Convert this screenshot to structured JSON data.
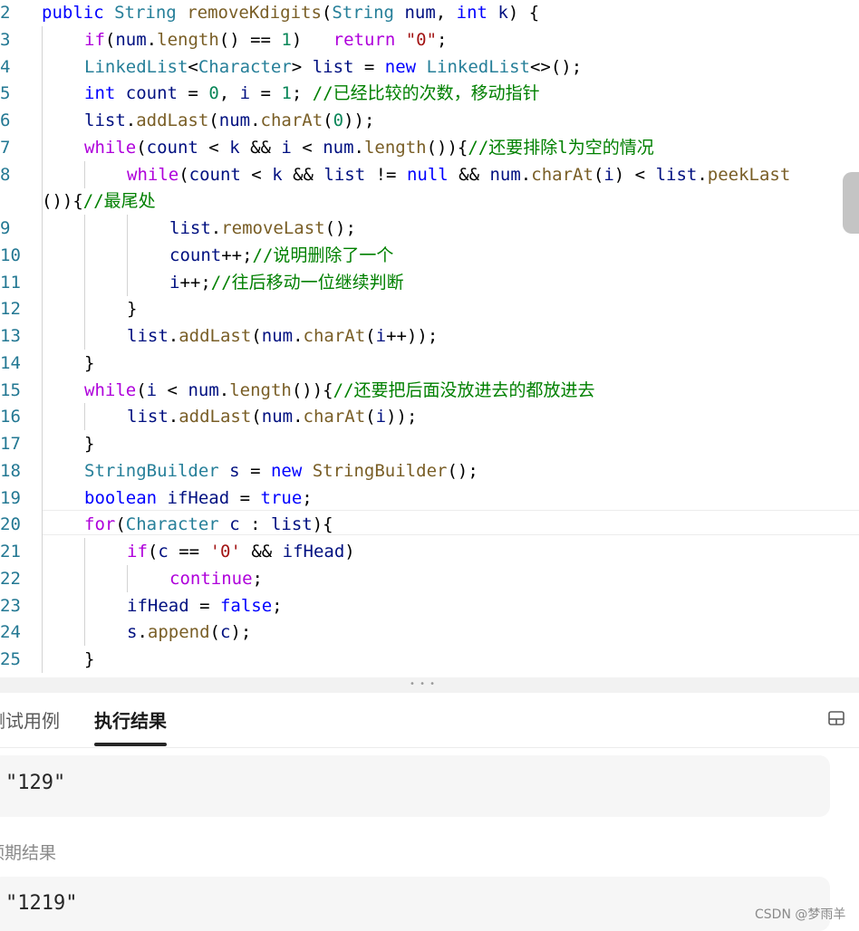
{
  "editor": {
    "lines": [
      {
        "num": "2",
        "indent": 0,
        "tokens": [
          [
            "k",
            "public"
          ],
          [
            "p",
            " "
          ],
          [
            "t",
            "String"
          ],
          [
            "p",
            " "
          ],
          [
            "f",
            "removeKdigits"
          ],
          [
            "p",
            "("
          ],
          [
            "t",
            "String"
          ],
          [
            "p",
            " "
          ],
          [
            "v",
            "num"
          ],
          [
            "p",
            ", "
          ],
          [
            "k",
            "int"
          ],
          [
            "p",
            " "
          ],
          [
            "v",
            "k"
          ],
          [
            "p",
            ") {"
          ]
        ]
      },
      {
        "num": "3",
        "indent": 1,
        "tokens": [
          [
            "c",
            "if"
          ],
          [
            "p",
            "("
          ],
          [
            "v",
            "num"
          ],
          [
            "p",
            "."
          ],
          [
            "f",
            "length"
          ],
          [
            "p",
            "() == "
          ],
          [
            "n",
            "1"
          ],
          [
            "p",
            ")   "
          ],
          [
            "c",
            "return"
          ],
          [
            "p",
            " "
          ],
          [
            "s",
            "\"0\""
          ],
          [
            "p",
            ";"
          ]
        ]
      },
      {
        "num": "4",
        "indent": 1,
        "tokens": [
          [
            "t",
            "LinkedList"
          ],
          [
            "p",
            "<"
          ],
          [
            "t",
            "Character"
          ],
          [
            "p",
            "> "
          ],
          [
            "v",
            "list"
          ],
          [
            "p",
            " = "
          ],
          [
            "k",
            "new"
          ],
          [
            "p",
            " "
          ],
          [
            "t",
            "LinkedList"
          ],
          [
            "p",
            "<>();"
          ]
        ]
      },
      {
        "num": "5",
        "indent": 1,
        "tokens": [
          [
            "k",
            "int"
          ],
          [
            "p",
            " "
          ],
          [
            "v",
            "count"
          ],
          [
            "p",
            " = "
          ],
          [
            "n",
            "0"
          ],
          [
            "p",
            ", "
          ],
          [
            "v",
            "i"
          ],
          [
            "p",
            " = "
          ],
          [
            "n",
            "1"
          ],
          [
            "p",
            "; "
          ],
          [
            "m",
            "//已经比较的次数，移动指针"
          ]
        ]
      },
      {
        "num": "6",
        "indent": 1,
        "tokens": [
          [
            "v",
            "list"
          ],
          [
            "p",
            "."
          ],
          [
            "f",
            "addLast"
          ],
          [
            "p",
            "("
          ],
          [
            "v",
            "num"
          ],
          [
            "p",
            "."
          ],
          [
            "f",
            "charAt"
          ],
          [
            "p",
            "("
          ],
          [
            "n",
            "0"
          ],
          [
            "p",
            "));"
          ]
        ]
      },
      {
        "num": "7",
        "indent": 1,
        "tokens": [
          [
            "c",
            "while"
          ],
          [
            "p",
            "("
          ],
          [
            "v",
            "count"
          ],
          [
            "p",
            " < "
          ],
          [
            "v",
            "k"
          ],
          [
            "p",
            " && "
          ],
          [
            "v",
            "i"
          ],
          [
            "p",
            " < "
          ],
          [
            "v",
            "num"
          ],
          [
            "p",
            "."
          ],
          [
            "f",
            "length"
          ],
          [
            "p",
            "()){"
          ],
          [
            "m",
            "//还要排除l为空的情况"
          ]
        ]
      },
      {
        "num": "8",
        "indent": 2,
        "tokens": [
          [
            "c",
            "while"
          ],
          [
            "p",
            "("
          ],
          [
            "v",
            "count"
          ],
          [
            "p",
            " < "
          ],
          [
            "v",
            "k"
          ],
          [
            "p",
            " && "
          ],
          [
            "v",
            "list"
          ],
          [
            "p",
            " != "
          ],
          [
            "k",
            "null"
          ],
          [
            "p",
            " && "
          ],
          [
            "v",
            "num"
          ],
          [
            "p",
            "."
          ],
          [
            "f",
            "charAt"
          ],
          [
            "p",
            "("
          ],
          [
            "v",
            "i"
          ],
          [
            "p",
            ") < "
          ],
          [
            "v",
            "list"
          ],
          [
            "p",
            "."
          ],
          [
            "f",
            "peekLast"
          ]
        ]
      },
      {
        "num": "",
        "indent": 0,
        "wrap": true,
        "tokens": [
          [
            "p",
            "()){"
          ],
          [
            "m",
            "//最尾处"
          ]
        ]
      },
      {
        "num": "9",
        "indent": 3,
        "tokens": [
          [
            "v",
            "list"
          ],
          [
            "p",
            "."
          ],
          [
            "f",
            "removeLast"
          ],
          [
            "p",
            "();"
          ]
        ]
      },
      {
        "num": "10",
        "indent": 3,
        "tokens": [
          [
            "v",
            "count"
          ],
          [
            "p",
            "++;"
          ],
          [
            "m",
            "//说明删除了一个"
          ]
        ]
      },
      {
        "num": "11",
        "indent": 3,
        "tokens": [
          [
            "v",
            "i"
          ],
          [
            "p",
            "++;"
          ],
          [
            "m",
            "//往后移动一位继续判断"
          ]
        ]
      },
      {
        "num": "12",
        "indent": 2,
        "tokens": [
          [
            "p",
            "}"
          ]
        ]
      },
      {
        "num": "13",
        "indent": 2,
        "tokens": [
          [
            "v",
            "list"
          ],
          [
            "p",
            "."
          ],
          [
            "f",
            "addLast"
          ],
          [
            "p",
            "("
          ],
          [
            "v",
            "num"
          ],
          [
            "p",
            "."
          ],
          [
            "f",
            "charAt"
          ],
          [
            "p",
            "("
          ],
          [
            "v",
            "i"
          ],
          [
            "p",
            "++));"
          ]
        ]
      },
      {
        "num": "14",
        "indent": 1,
        "tokens": [
          [
            "p",
            "}"
          ]
        ]
      },
      {
        "num": "15",
        "indent": 1,
        "tokens": [
          [
            "c",
            "while"
          ],
          [
            "p",
            "("
          ],
          [
            "v",
            "i"
          ],
          [
            "p",
            " < "
          ],
          [
            "v",
            "num"
          ],
          [
            "p",
            "."
          ],
          [
            "f",
            "length"
          ],
          [
            "p",
            "()){"
          ],
          [
            "m",
            "//还要把后面没放进去的都放进去"
          ]
        ]
      },
      {
        "num": "16",
        "indent": 2,
        "tokens": [
          [
            "v",
            "list"
          ],
          [
            "p",
            "."
          ],
          [
            "f",
            "addLast"
          ],
          [
            "p",
            "("
          ],
          [
            "v",
            "num"
          ],
          [
            "p",
            "."
          ],
          [
            "f",
            "charAt"
          ],
          [
            "p",
            "("
          ],
          [
            "v",
            "i"
          ],
          [
            "p",
            "));"
          ]
        ]
      },
      {
        "num": "17",
        "indent": 1,
        "tokens": [
          [
            "p",
            "}"
          ]
        ]
      },
      {
        "num": "18",
        "indent": 1,
        "tokens": [
          [
            "t",
            "StringBuilder"
          ],
          [
            "p",
            " "
          ],
          [
            "v",
            "s"
          ],
          [
            "p",
            " = "
          ],
          [
            "k",
            "new"
          ],
          [
            "p",
            " "
          ],
          [
            "f",
            "StringBuilder"
          ],
          [
            "p",
            "();"
          ]
        ]
      },
      {
        "num": "19",
        "indent": 1,
        "tokens": [
          [
            "k",
            "boolean"
          ],
          [
            "p",
            " "
          ],
          [
            "v",
            "ifHead"
          ],
          [
            "p",
            " = "
          ],
          [
            "k",
            "true"
          ],
          [
            "p",
            ";"
          ]
        ]
      },
      {
        "num": "20",
        "indent": 1,
        "tokens": [
          [
            "c",
            "for"
          ],
          [
            "p",
            "("
          ],
          [
            "t",
            "Character"
          ],
          [
            "p",
            " "
          ],
          [
            "v",
            "c"
          ],
          [
            "p",
            " : "
          ],
          [
            "v",
            "list"
          ],
          [
            "p",
            "){"
          ]
        ]
      },
      {
        "num": "21",
        "indent": 2,
        "tokens": [
          [
            "c",
            "if"
          ],
          [
            "p",
            "("
          ],
          [
            "v",
            "c"
          ],
          [
            "p",
            " == "
          ],
          [
            "s",
            "'0'"
          ],
          [
            "p",
            " && "
          ],
          [
            "v",
            "ifHead"
          ],
          [
            "p",
            ")"
          ]
        ]
      },
      {
        "num": "22",
        "indent": 3,
        "tokens": [
          [
            "c",
            "continue"
          ],
          [
            "p",
            ";"
          ]
        ]
      },
      {
        "num": "23",
        "indent": 2,
        "tokens": [
          [
            "v",
            "ifHead"
          ],
          [
            "p",
            " = "
          ],
          [
            "k",
            "false"
          ],
          [
            "p",
            ";"
          ]
        ]
      },
      {
        "num": "24",
        "indent": 2,
        "tokens": [
          [
            "v",
            "s"
          ],
          [
            "p",
            "."
          ],
          [
            "f",
            "append"
          ],
          [
            "p",
            "("
          ],
          [
            "v",
            "c"
          ],
          [
            "p",
            ");"
          ]
        ]
      },
      {
        "num": "25",
        "indent": 1,
        "tokens": [
          [
            "p",
            "}"
          ]
        ]
      }
    ]
  },
  "tabs": {
    "testcase_label": "测试用例",
    "result_label": "执行结果"
  },
  "output": {
    "value": "\"129\""
  },
  "expected": {
    "label": "预期结果",
    "value": "\"1219\""
  },
  "watermark": "CSDN @梦雨羊",
  "icons": {
    "layout": "panel-layout-icon"
  }
}
